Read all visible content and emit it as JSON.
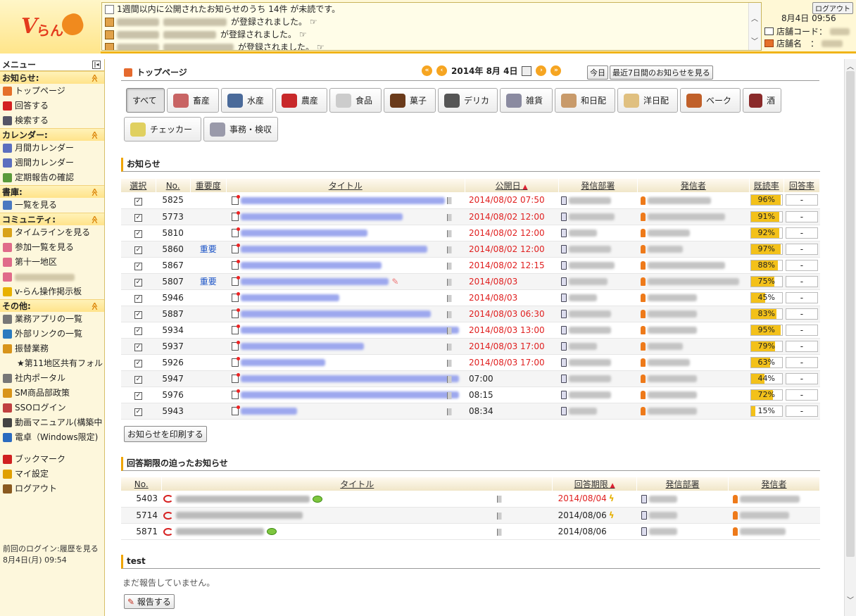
{
  "header": {
    "logo_text_v": "V",
    "logo_text_ran": "らん",
    "ticker": [
      {
        "text": "1週間以内に公開されたお知らせのうち 14件 が未読です。",
        "icon": "doc-icon"
      },
      {
        "text": "が登録されました。",
        "icon": "stack-icon"
      },
      {
        "text": "が登録されました。",
        "icon": "stack-icon"
      },
      {
        "text": "が登録されました。",
        "icon": "stack-icon"
      }
    ],
    "logout_label": "ログアウト",
    "datetime": "8月4日 09:56",
    "store_code_label": "店舗コード：",
    "store_name_label": "店舗名　：",
    "colors": {
      "accent": "#f0b418",
      "logo_red": "#e33a1c"
    }
  },
  "sidebar": {
    "title": "メニュー",
    "sections": [
      {
        "name": "お知らせ:",
        "items": [
          {
            "label": "トップページ",
            "icon": "home-icon",
            "color": "#e5702a"
          },
          {
            "label": "回答する",
            "icon": "reply-icon",
            "color": "#d32020"
          },
          {
            "label": "検索する",
            "icon": "search-icon",
            "color": "#556"
          }
        ]
      },
      {
        "name": "カレンダー:",
        "items": [
          {
            "label": "月間カレンダー",
            "icon": "calendar-icon",
            "color": "#5b6fbf"
          },
          {
            "label": "週間カレンダー",
            "icon": "calendar-week-icon",
            "color": "#5b6fbf"
          },
          {
            "label": "定期報告の確認",
            "icon": "report-icon",
            "color": "#5a9a3a"
          }
        ]
      },
      {
        "name": "書庫:",
        "items": [
          {
            "label": "一覧を見る",
            "icon": "box-icon",
            "color": "#4a78c0"
          }
        ]
      },
      {
        "name": "コミュニティ:",
        "items": [
          {
            "label": "タイムラインを見る",
            "icon": "people-icon",
            "color": "#d8a21a"
          },
          {
            "label": "参加一覧を見る",
            "icon": "people-pink-icon",
            "color": "#e06b8a"
          },
          {
            "label": "第十一地区",
            "icon": "people-pink-icon",
            "color": "#e06b8a"
          },
          {
            "label": "",
            "icon": "people-pink-icon",
            "color": "#e06b8a"
          },
          {
            "label": "v-らん操作掲示板",
            "icon": "question-icon",
            "color": "#e8b100"
          }
        ]
      },
      {
        "name": "その他:",
        "items": [
          {
            "label": "業務アプリの一覧",
            "icon": "grid-icon",
            "color": "#777"
          },
          {
            "label": "外部リンクの一覧",
            "icon": "globe-icon",
            "color": "#2b7bbf"
          },
          {
            "label": "振替業務",
            "icon": "stack-icon",
            "color": "#d8941a"
          },
          {
            "label": "★第11地区共有フォル",
            "icon": "",
            "color": "",
            "sub": true
          },
          {
            "label": "社内ポータル",
            "icon": "building-icon",
            "color": "#777"
          },
          {
            "label": "SM商品部政策",
            "icon": "hand-icon",
            "color": "#d8941a"
          },
          {
            "label": "SSOログイン",
            "icon": "sso-icon",
            "color": "#c04040"
          },
          {
            "label": "動画マニュアル(構築中",
            "icon": "film-icon",
            "color": "#444"
          },
          {
            "label": "電卓（Windows限定)",
            "icon": "calculator-icon",
            "color": "#2b6bbf"
          },
          {
            "label": "",
            "icon": "",
            "color": ""
          },
          {
            "label": "ブックマーク",
            "icon": "flag-icon",
            "color": "#d02020"
          },
          {
            "label": "マイ設定",
            "icon": "settings-icon",
            "color": "#e0a000"
          },
          {
            "label": "ログアウト",
            "icon": "door-icon",
            "color": "#8a5a20"
          }
        ]
      }
    ],
    "last_login_label": "前回のログイン:",
    "last_login_link": "履歴を見る",
    "last_login_date": "8月4日(月) 09:54"
  },
  "main": {
    "page_title": "トップページ",
    "date_label": "2014年 8月 4日",
    "today_button": "今日",
    "recent_button": "最近7日間のお知らせを見る",
    "categories": [
      {
        "label": "すべて",
        "icon": "",
        "selected": true,
        "color": ""
      },
      {
        "label": "畜産",
        "icon": "meat-icon",
        "color": "#c86464"
      },
      {
        "label": "水産",
        "icon": "fish-icon",
        "color": "#4a6a9a"
      },
      {
        "label": "農産",
        "icon": "vegetable-icon",
        "color": "#c8282a"
      },
      {
        "label": "食品",
        "icon": "bowl-icon",
        "color": "#cccccc"
      },
      {
        "label": "菓子",
        "icon": "bear-icon",
        "color": "#6a3a1a"
      },
      {
        "label": "デリカ",
        "icon": "pan-icon",
        "color": "#555555"
      },
      {
        "label": "雑貨",
        "icon": "tool-icon",
        "color": "#8a8aa0"
      },
      {
        "label": "和日配",
        "icon": "tofu-icon",
        "color": "#c89a6a"
      },
      {
        "label": "洋日配",
        "icon": "milk-icon",
        "color": "#e0c080"
      },
      {
        "label": "ベーク",
        "icon": "bread-icon",
        "color": "#c0602a"
      },
      {
        "label": "酒",
        "icon": "bottle-icon",
        "color": "#8a2a2a"
      },
      {
        "label": "チェッカー",
        "icon": "checker-icon",
        "color": "#e0d060"
      },
      {
        "label": "事務・検収",
        "icon": "paper-icon",
        "color": "#9a9aaa"
      }
    ],
    "notices": {
      "heading": "お知らせ",
      "columns": [
        "選択",
        "No.",
        "重要度",
        "タイトル",
        "公開日",
        "発信部署",
        "発信者",
        "既読率",
        "回答率"
      ],
      "rows": [
        {
          "no": "5825",
          "importance": "",
          "date": "2014/08/02 07:50",
          "red": true,
          "rate": 96,
          "rate_text": "96%",
          "answer": "-",
          "tw": 290,
          "dw": 60,
          "pw": 90
        },
        {
          "no": "5773",
          "importance": "",
          "date": "2014/08/02 12:00",
          "red": true,
          "rate": 91,
          "rate_text": "91%",
          "answer": "-",
          "tw": 230,
          "dw": 65,
          "pw": 110
        },
        {
          "no": "5810",
          "importance": "",
          "date": "2014/08/02 12:00",
          "red": true,
          "rate": 92,
          "rate_text": "92%",
          "answer": "-",
          "tw": 180,
          "dw": 40,
          "pw": 60
        },
        {
          "no": "5860",
          "importance": "重要",
          "date": "2014/08/02 12:00",
          "red": true,
          "rate": 97,
          "rate_text": "97%",
          "answer": "-",
          "tw": 265,
          "dw": 60,
          "pw": 50
        },
        {
          "no": "5867",
          "importance": "",
          "date": "2014/08/02 12:15",
          "red": true,
          "rate": 88,
          "rate_text": "88%",
          "answer": "-",
          "tw": 200,
          "dw": 65,
          "pw": 110
        },
        {
          "no": "5807",
          "importance": "重要",
          "date": "2014/08/03",
          "red": true,
          "rate": 75,
          "rate_text": "75%",
          "answer": "-",
          "tw": 210,
          "dw": 55,
          "pw": 130
        },
        {
          "no": "5946",
          "importance": "",
          "date": "2014/08/03",
          "red": true,
          "rate": 45,
          "rate_text": "45%",
          "answer": "-",
          "tw": 140,
          "dw": 40,
          "pw": 70
        },
        {
          "no": "5887",
          "importance": "",
          "date": "2014/08/03 06:30",
          "red": true,
          "rate": 83,
          "rate_text": "83%",
          "answer": "-",
          "tw": 270,
          "dw": 60,
          "pw": 70
        },
        {
          "no": "5934",
          "importance": "",
          "date": "2014/08/03 13:00",
          "red": true,
          "rate": 95,
          "rate_text": "95%",
          "answer": "-",
          "tw": 310,
          "dw": 60,
          "pw": 70
        },
        {
          "no": "5937",
          "importance": "",
          "date": "2014/08/03 17:00",
          "red": true,
          "rate": 79,
          "rate_text": "79%",
          "answer": "-",
          "tw": 175,
          "dw": 40,
          "pw": 50
        },
        {
          "no": "5926",
          "importance": "",
          "date": "2014/08/03 17:00",
          "red": true,
          "rate": 63,
          "rate_text": "63%",
          "answer": "-",
          "tw": 120,
          "dw": 60,
          "pw": 60
        },
        {
          "no": "5947",
          "importance": "",
          "date": "07:00",
          "red": false,
          "rate": 44,
          "rate_text": "44%",
          "answer": "-",
          "tw": 310,
          "dw": 60,
          "pw": 70
        },
        {
          "no": "5976",
          "importance": "",
          "date": "08:15",
          "red": false,
          "rate": 72,
          "rate_text": "72%",
          "answer": "-",
          "tw": 310,
          "dw": 60,
          "pw": 70
        },
        {
          "no": "5943",
          "importance": "",
          "date": "08:34",
          "red": false,
          "rate": 15,
          "rate_text": "15%",
          "answer": "-",
          "tw": 80,
          "dw": 40,
          "pw": 70
        }
      ],
      "print_button": "お知らせを印刷する"
    },
    "deadline": {
      "heading": "回答期限の迫ったお知らせ",
      "columns": [
        "No.",
        "タイトル",
        "回答期限",
        "発信部署",
        "発信者"
      ],
      "rows": [
        {
          "no": "5403",
          "date": "2014/08/04",
          "red": true,
          "bolt": true,
          "bubble": true,
          "tw": 190,
          "dw": 40,
          "pw": 85
        },
        {
          "no": "5714",
          "date": "2014/08/06",
          "red": false,
          "bolt": true,
          "bubble": false,
          "tw": 180,
          "dw": 40,
          "pw": 70
        },
        {
          "no": "5871",
          "date": "2014/08/06",
          "red": false,
          "bolt": false,
          "bubble": true,
          "tw": 125,
          "dw": 40,
          "pw": 65
        }
      ]
    },
    "test": {
      "heading": "test",
      "message": "まだ報告していません。",
      "report_button": "報告する"
    }
  }
}
